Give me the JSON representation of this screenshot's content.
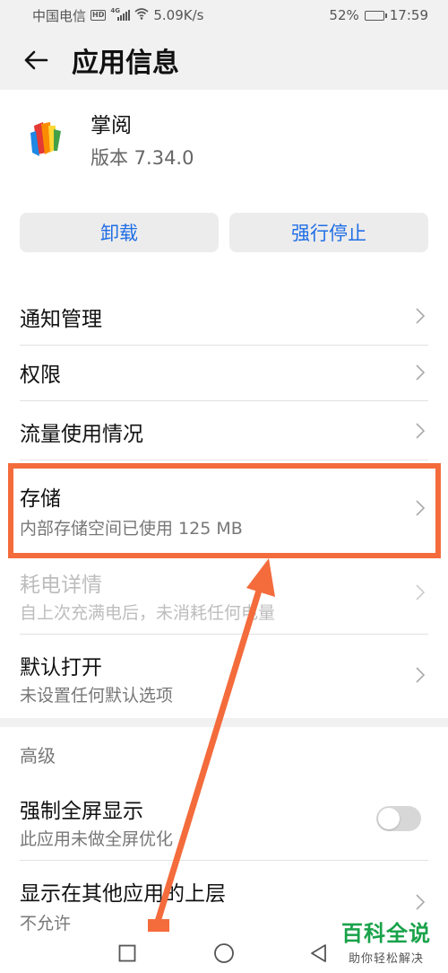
{
  "status_bar": {
    "carrier": "中国电信",
    "network_speed": "5.09K/s",
    "battery_percent": "52%",
    "time": "17:59"
  },
  "header": {
    "title": "应用信息"
  },
  "app": {
    "name": "掌阅",
    "version": "版本 7.34.0"
  },
  "actions": {
    "uninstall": "卸载",
    "force_stop": "强行停止"
  },
  "settings": [
    {
      "title": "通知管理",
      "subtitle": "",
      "enabled": true
    },
    {
      "title": "权限",
      "subtitle": "",
      "enabled": true
    },
    {
      "title": "流量使用情况",
      "subtitle": "",
      "enabled": true
    },
    {
      "title": "存储",
      "subtitle": "内部存储空间已使用 125 MB",
      "enabled": true
    },
    {
      "title": "耗电详情",
      "subtitle": "自上次充满电后，未消耗任何电量",
      "enabled": false
    },
    {
      "title": "默认打开",
      "subtitle": "未设置任何默认选项",
      "enabled": true
    }
  ],
  "advanced": {
    "label": "高级",
    "items": [
      {
        "title": "强制全屏显示",
        "subtitle": "此应用未做全屏优化",
        "toggle_on": false
      },
      {
        "title": "显示在其他应用的上层",
        "subtitle": "不允许"
      }
    ]
  },
  "watermark": {
    "line1": "百科全说",
    "line2": "助你轻松解决"
  },
  "colors": {
    "accent": "#1f6ee6",
    "annotation": "#f46b3c",
    "watermark": "#19a24a"
  }
}
